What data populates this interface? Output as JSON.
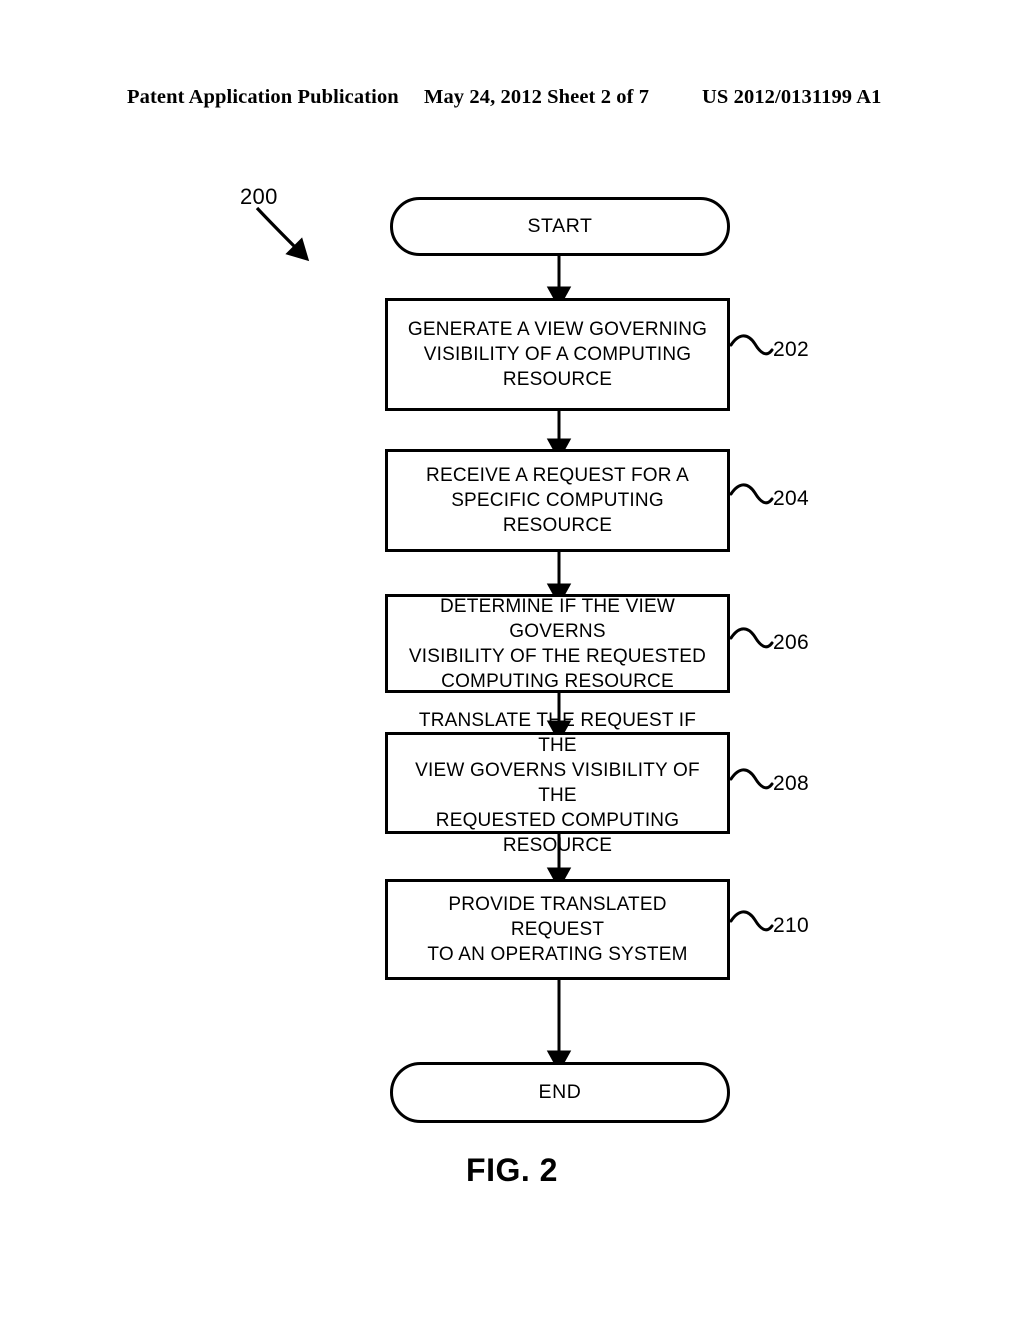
{
  "header": {
    "left": "Patent Application Publication",
    "middle": "May 24, 2012  Sheet 2 of 7",
    "right": "US 2012/0131199 A1"
  },
  "figure": {
    "caption": "FIG. 2",
    "figure_number": "200",
    "nodes": [
      {
        "id": "start",
        "shape": "terminator",
        "label": "START",
        "ref": ""
      },
      {
        "id": "step-202",
        "shape": "process",
        "label": "GENERATE A VIEW GOVERNING\nVISIBILITY OF A COMPUTING\nRESOURCE",
        "ref": "202"
      },
      {
        "id": "step-204",
        "shape": "process",
        "label": "RECEIVE A REQUEST FOR A\nSPECIFIC COMPUTING RESOURCE",
        "ref": "204"
      },
      {
        "id": "step-206",
        "shape": "process",
        "label": "DETERMINE IF THE VIEW GOVERNS\nVISIBILITY OF THE REQUESTED\nCOMPUTING RESOURCE",
        "ref": "206"
      },
      {
        "id": "step-208",
        "shape": "process",
        "label": "TRANSLATE THE REQUEST IF THE\nVIEW GOVERNS VISIBILITY OF THE\nREQUESTED COMPUTING\nRESOURCE",
        "ref": "208"
      },
      {
        "id": "step-210",
        "shape": "process",
        "label": "PROVIDE TRANSLATED REQUEST\nTO AN OPERATING SYSTEM",
        "ref": "210"
      },
      {
        "id": "end",
        "shape": "terminator",
        "label": "END",
        "ref": ""
      }
    ]
  }
}
